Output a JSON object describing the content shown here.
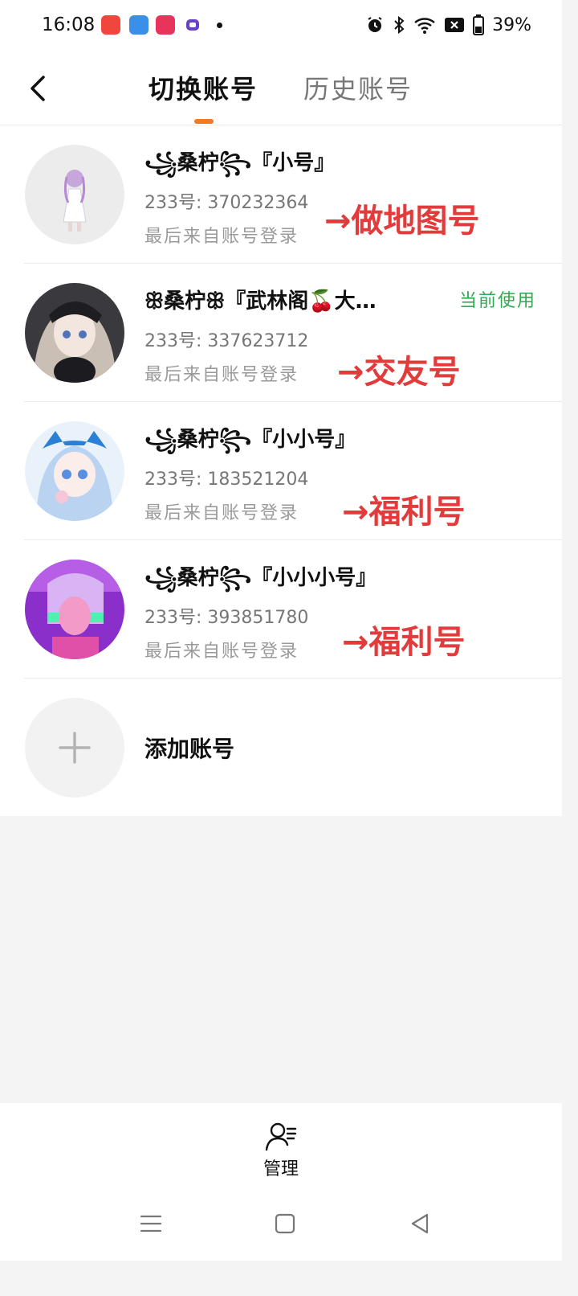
{
  "status_bar": {
    "time": "16:08",
    "battery": "39%"
  },
  "header": {
    "tab_active": "切换账号",
    "tab_inactive": "历史账号"
  },
  "accounts": [
    {
      "name": "꧁桑柠꧂『小号』",
      "uid": "233号: 370232364",
      "login": "最后来自账号登录",
      "note": "→做地图号"
    },
    {
      "name": "ꕥ桑柠ꕥ『武林阁🍒大…",
      "uid": "233号: 337623712",
      "login": "最后来自账号登录",
      "note": "→交友号",
      "current": "当前使用"
    },
    {
      "name": "꧁桑柠꧂『小小号』",
      "uid": "233号: 183521204",
      "login": "最后来自账号登录",
      "note": "→福利号"
    },
    {
      "name": "꧁桑柠꧂『小小小号』",
      "uid": "233号: 393851780",
      "login": "最后来自账号登录",
      "note": "→福利号"
    }
  ],
  "add_account": {
    "label": "添加账号"
  },
  "bottom": {
    "manage_label": "管理"
  },
  "colors": {
    "accent": "#f47a20",
    "note_red": "#e13b3b",
    "current_green": "#2eaa52"
  }
}
